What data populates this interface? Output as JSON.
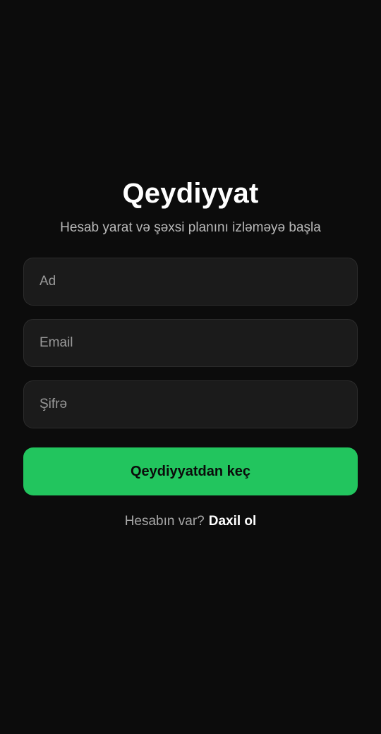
{
  "header": {
    "title": "Qeydiyyat",
    "subtitle": "Hesab yarat və şəxsi planını izləməyə başla"
  },
  "form": {
    "name_placeholder": "Ad",
    "email_placeholder": "Email",
    "password_placeholder": "Şifrə",
    "submit_label": "Qeydiyyatdan keç"
  },
  "footer": {
    "prompt": "Hesabın var?",
    "login_label": "Daxil ol"
  },
  "colors": {
    "background": "#0c0c0c",
    "field_background": "#1b1b1b",
    "accent": "#22c55e"
  }
}
